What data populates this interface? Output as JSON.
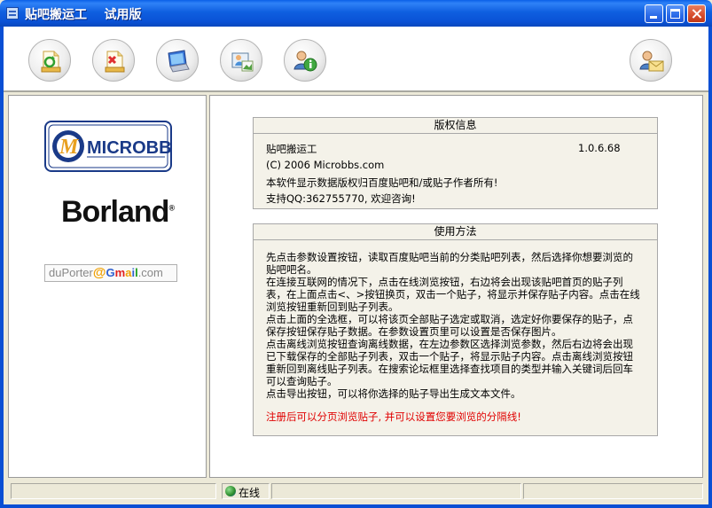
{
  "window": {
    "title": "贴吧搬运工    试用版"
  },
  "toolbar": {
    "buttons": [
      {
        "name": "refresh",
        "icon": "document-refresh-icon"
      },
      {
        "name": "delete",
        "icon": "document-delete-icon"
      },
      {
        "name": "browse",
        "icon": "monitor-icon"
      },
      {
        "name": "export-images",
        "icon": "picture-icon"
      },
      {
        "name": "about",
        "icon": "info-user-icon"
      },
      {
        "name": "contact",
        "icon": "mail-user-icon"
      }
    ]
  },
  "left_panel": {
    "logo_microbbs": "MICROBBS",
    "logo_borland": "Borland",
    "logo_duporter_prefix": "duPorter",
    "logo_duporter_at": "@",
    "logo_gmail": [
      "G",
      "m",
      "a",
      "i",
      "l"
    ],
    "logo_duporter_suffix": ".com"
  },
  "copyright": {
    "header": "版权信息",
    "app_name": "贴吧搬运工",
    "version": "1.0.6.68",
    "company": "(C) 2006 Microbbs.com",
    "notice": "本软件显示数据版权归百度贴吧和/或贴子作者所有!",
    "support": "支持QQ:362755770, 欢迎咨询!"
  },
  "usage": {
    "header": "使用方法",
    "paragraphs": [
      "先点击参数设置按钮，读取百度贴吧当前的分类贴吧列表，然后选择你想要浏览的贴吧吧名。",
      "在连接互联网的情况下，点击在线浏览按钮，右边将会出现该贴吧首页的贴子列表，在上面点击<、>按钮换页，双击一个贴子，将显示并保存贴子内容。点击在线浏览按钮重新回到贴子列表。",
      "点击上面的全选框，可以将该页全部贴子选定或取消，选定好你要保存的贴子，点保存按钮保存贴子数据。在参数设置页里可以设置是否保存图片。",
      "点击离线浏览按钮查询离线数据，在左边参数区选择浏览参数，然后右边将会出现已下载保存的全部贴子列表，双击一个贴子，将显示贴子内容。点击离线浏览按钮重新回到离线贴子列表。在搜索论坛框里选择查找项目的类型并输入关键词后回车可以查询贴子。",
      "点击导出按钮，可以将你选择的贴子导出生成文本文件。"
    ],
    "note": "注册后可以分页浏览贴子, 并可以设置您要浏览的分隔线!"
  },
  "statusbar": {
    "online_label": "在线",
    "online_icon": "globe-icon"
  }
}
